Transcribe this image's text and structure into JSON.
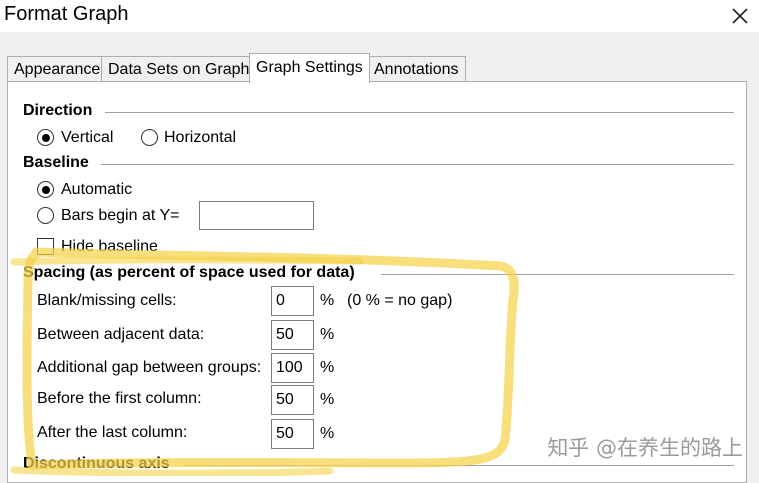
{
  "window": {
    "title": "Format Graph"
  },
  "tabs": [
    {
      "label": "Appearance",
      "active": false
    },
    {
      "label": "Data Sets on Graph",
      "active": false
    },
    {
      "label": "Graph Settings",
      "active": true
    },
    {
      "label": "Annotations",
      "active": false
    }
  ],
  "direction": {
    "heading": "Direction",
    "options": [
      {
        "label": "Vertical",
        "selected": true
      },
      {
        "label": "Horizontal",
        "selected": false
      }
    ]
  },
  "baseline": {
    "heading": "Baseline",
    "automatic_label": "Automatic",
    "automatic_selected": true,
    "bars_begin_label": "Bars begin at Y=",
    "bars_begin_value": "",
    "hide_label": "Hide baseline",
    "hide_checked": false
  },
  "spacing": {
    "heading": "Spacing (as percent of space used for data)",
    "unit": "%",
    "rows": [
      {
        "label": "Blank/missing cells:",
        "value": "0",
        "note": "(0 % = no gap)"
      },
      {
        "label": "Between adjacent data:",
        "value": "50",
        "note": ""
      },
      {
        "label": "Additional gap between groups:",
        "value": "100",
        "note": ""
      },
      {
        "label": "Before the first column:",
        "value": "50",
        "note": ""
      },
      {
        "label": "After the last column:",
        "value": "50",
        "note": ""
      }
    ]
  },
  "discontinuous": {
    "heading": "Discontinuous axis"
  },
  "watermark": "知乎 @在养生的路上",
  "colors": {
    "highlight": "#f5d24a",
    "panel": "#ffffff",
    "dialog": "#f0f0f0",
    "watermark": "#9b9b9b"
  }
}
